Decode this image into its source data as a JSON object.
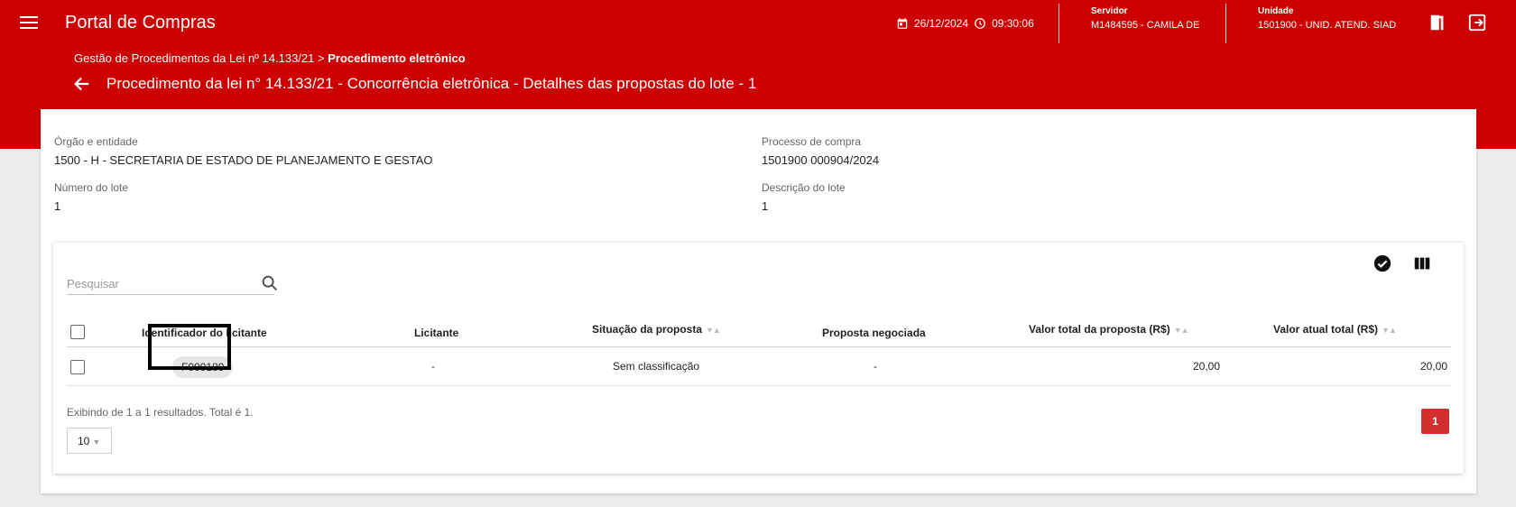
{
  "header": {
    "app_title": "Portal de Compras",
    "date": "26/12/2024",
    "time": "09:30:06",
    "servidor_label": "Servidor",
    "servidor_value": "M1484595 - CAMILA DE",
    "unidade_label": "Unidade",
    "unidade_value": "1501900 - UNID. ATEND. SIAD"
  },
  "breadcrumb": {
    "parent": "Gestão de Procedimentos da Lei nº 14.133/21",
    "separator": ">",
    "current": "Procedimento eletrônico"
  },
  "page_title": "Procedimento da lei n° 14.133/21 - Concorrência eletrônica - Detalhes das propostas do lote - 1",
  "details": {
    "orgao_label": "Órgão e entidade",
    "orgao_value": "1500 - H - SECRETARIA DE ESTADO DE PLANEJAMENTO E GESTAO",
    "processo_label": "Processo de compra",
    "processo_value": "1501900 000904/2024",
    "lote_label": "Número do lote",
    "lote_value": "1",
    "descricao_label": "Descrição do lote",
    "descricao_value": "1"
  },
  "table": {
    "search_placeholder": "Pesquisar",
    "columns": [
      "Identificador do licitante",
      "Licitante",
      "Situação da proposta",
      "Proposta negociada",
      "Valor total da proposta (R$)",
      "Valor atual total (R$)"
    ],
    "rows": [
      {
        "identificador": "F000189",
        "licitante": "-",
        "situacao": "Sem classificação",
        "negociada": "-",
        "valor_total": "20,00",
        "valor_atual": "20,00"
      }
    ],
    "results_text": "Exibindo de 1 a 1 resultados. Total é 1.",
    "page_size": "10",
    "current_page": "1"
  },
  "colors": {
    "brand_red": "#cc0000",
    "page_button": "#d32f2f"
  }
}
